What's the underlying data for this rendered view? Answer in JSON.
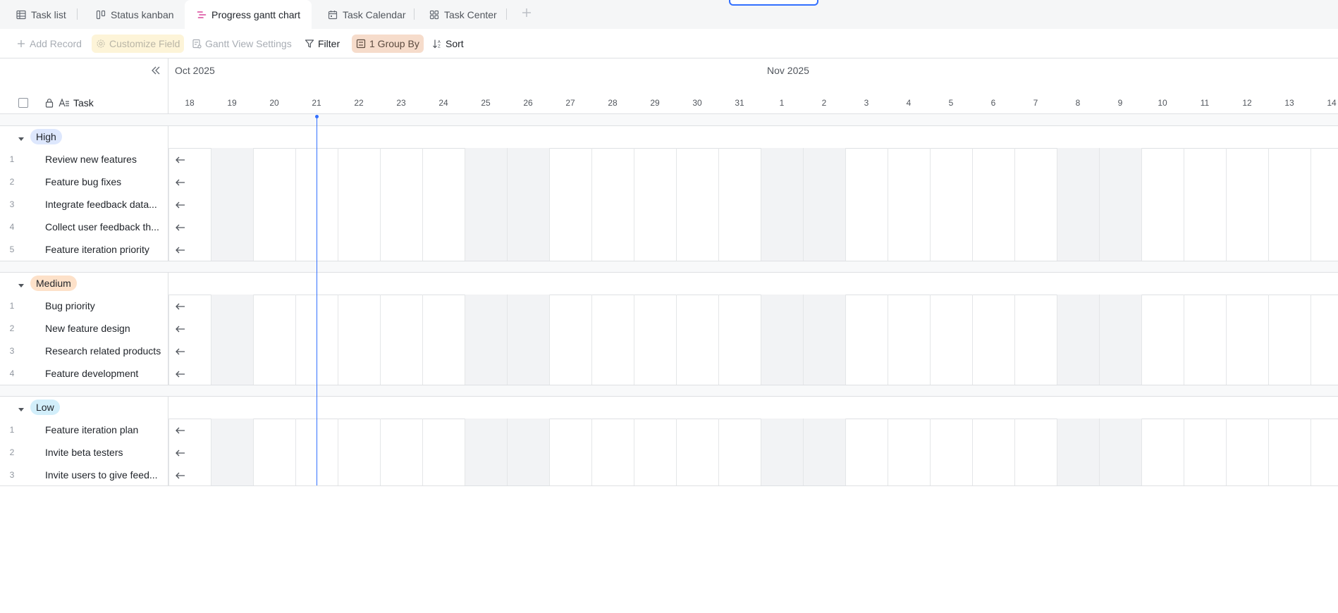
{
  "tabs": [
    {
      "label": "Task list",
      "icon": "table-icon"
    },
    {
      "label": "Status kanban",
      "icon": "kanban-icon"
    },
    {
      "label": "Progress gantt chart",
      "icon": "gantt-icon",
      "active": true
    },
    {
      "label": "Task Calendar",
      "icon": "calendar-icon"
    },
    {
      "label": "Task Center",
      "icon": "grid-icon"
    }
  ],
  "toolbar": {
    "add_record": "Add Record",
    "customize_field": "Customize Field",
    "gantt_settings": "Gantt View Settings",
    "filter": "Filter",
    "group_by": "1 Group By",
    "sort": "Sort"
  },
  "left_header": {
    "column_label": "Task"
  },
  "timeline": {
    "months": [
      "Oct 2025",
      "Nov 2025"
    ],
    "days": [
      "18",
      "19",
      "20",
      "21",
      "22",
      "23",
      "24",
      "25",
      "26",
      "27",
      "28",
      "29",
      "30",
      "31",
      "1",
      "2",
      "3",
      "4",
      "5",
      "6",
      "7",
      "8",
      "9",
      "10",
      "11",
      "12",
      "13",
      "14"
    ],
    "weekend_days": [
      "19",
      "25",
      "26",
      "1",
      "2",
      "8",
      "9"
    ],
    "today": "21"
  },
  "groups": [
    {
      "label": "High",
      "color": "#dde7fd",
      "tasks": [
        {
          "num": "1",
          "name": "Review new features"
        },
        {
          "num": "2",
          "name": "Feature bug fixes"
        },
        {
          "num": "3",
          "name": "Integrate feedback data..."
        },
        {
          "num": "4",
          "name": "Collect user feedback th..."
        },
        {
          "num": "5",
          "name": "Feature iteration priority"
        }
      ]
    },
    {
      "label": "Medium",
      "color": "#fde1c9",
      "tasks": [
        {
          "num": "1",
          "name": "Bug priority"
        },
        {
          "num": "2",
          "name": "New feature design"
        },
        {
          "num": "3",
          "name": "Research related products"
        },
        {
          "num": "4",
          "name": "Feature development"
        }
      ]
    },
    {
      "label": "Low",
      "color": "#d2eefa",
      "tasks": [
        {
          "num": "1",
          "name": "Feature iteration plan"
        },
        {
          "num": "2",
          "name": "Invite beta testers"
        },
        {
          "num": "3",
          "name": "Invite users to give feed..."
        }
      ]
    }
  ],
  "colors": {
    "accent": "#3370ff",
    "weekend": "#f2f3f5"
  }
}
